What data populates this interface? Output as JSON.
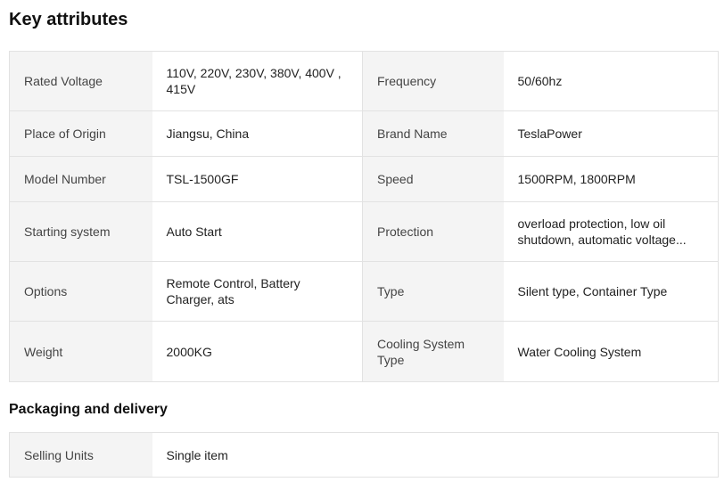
{
  "key_attributes": {
    "title": "Key attributes",
    "rows": [
      [
        {
          "label": "Rated Voltage",
          "value": "110V, 220V, 230V, 380V, 400V , 415V"
        },
        {
          "label": "Frequency",
          "value": "50/60hz"
        }
      ],
      [
        {
          "label": "Place of Origin",
          "value": "Jiangsu, China"
        },
        {
          "label": "Brand Name",
          "value": "TeslaPower"
        }
      ],
      [
        {
          "label": "Model Number",
          "value": "TSL-1500GF"
        },
        {
          "label": "Speed",
          "value": "1500RPM, 1800RPM"
        }
      ],
      [
        {
          "label": "Starting system",
          "value": "Auto Start"
        },
        {
          "label": "Protection",
          "value": "overload protection, low oil shutdown, automatic voltage..."
        }
      ],
      [
        {
          "label": "Options",
          "value": "Remote Control, Battery Charger, ats"
        },
        {
          "label": "Type",
          "value": "Silent type, Container Type"
        }
      ],
      [
        {
          "label": "Weight",
          "value": "2000KG"
        },
        {
          "label": "Cooling System Type",
          "value": "Water Cooling System"
        }
      ]
    ]
  },
  "packaging": {
    "title": "Packaging and delivery",
    "rows": [
      {
        "label": "Selling Units",
        "value": "Single item"
      }
    ]
  }
}
